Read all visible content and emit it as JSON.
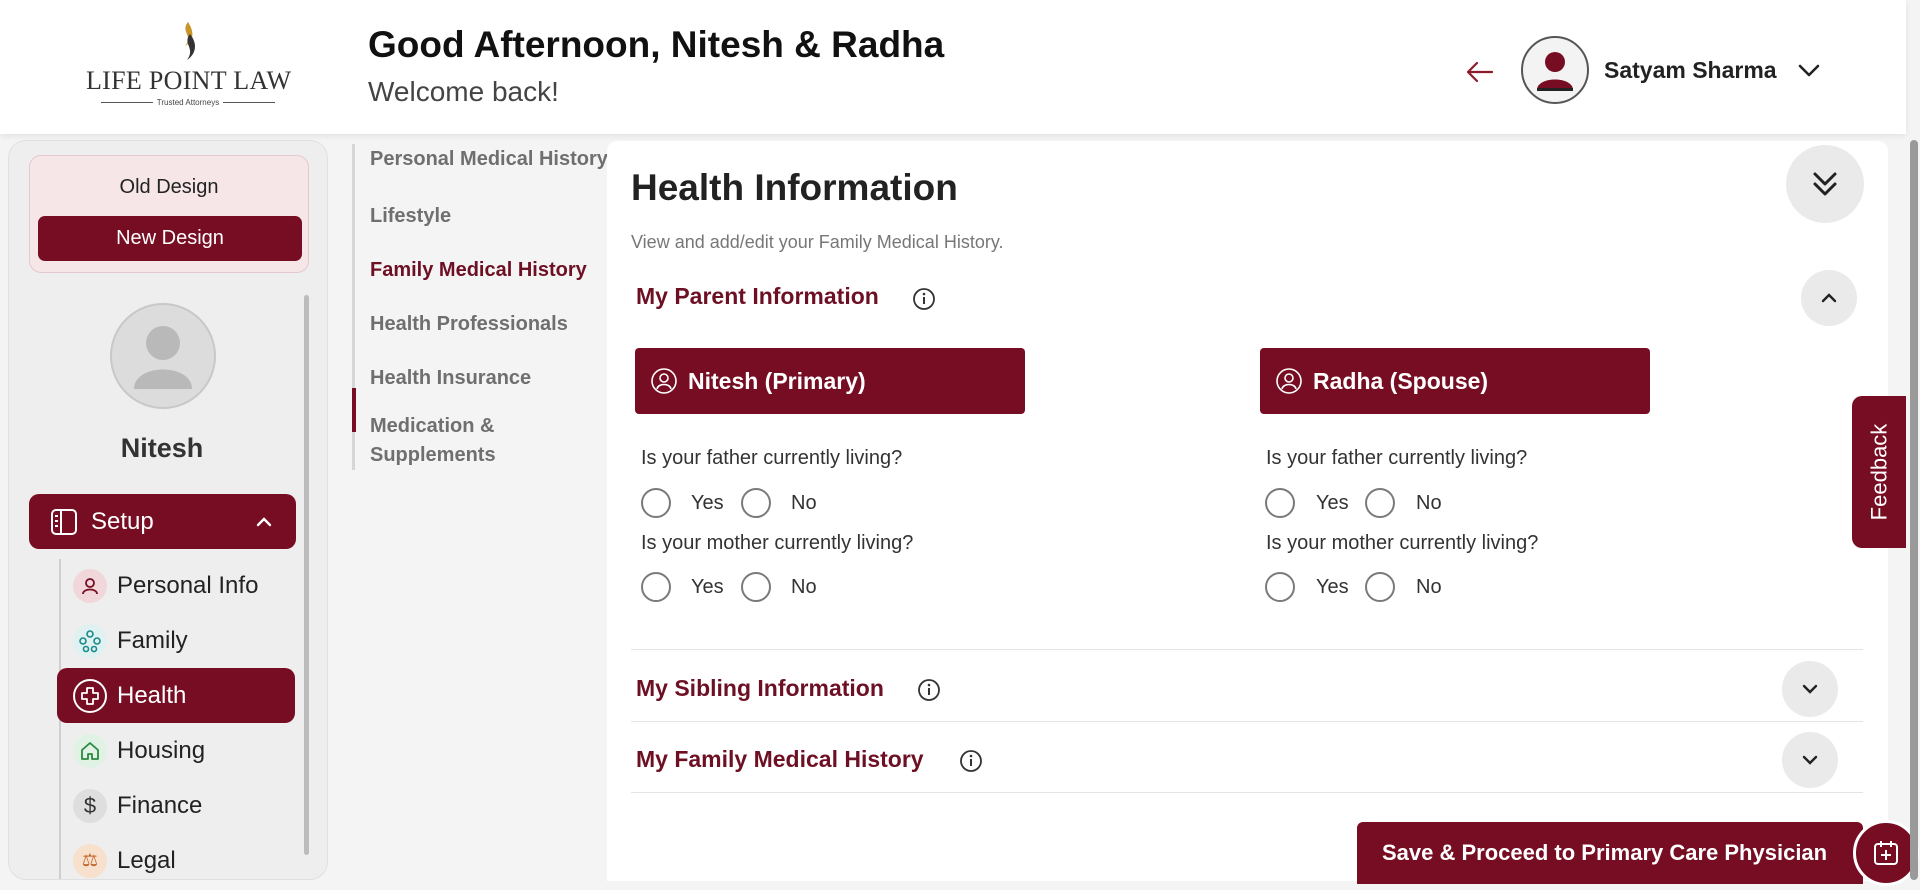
{
  "header": {
    "logo_text": "LIFE POINT LAW",
    "logo_tagline": "Trusted Attorneys",
    "greeting": "Good Afternoon, Nitesh & Radha",
    "welcome": "Welcome back!",
    "user_name": "Satyam Sharma"
  },
  "sidebar": {
    "old_design": "Old Design",
    "new_design": "New Design",
    "profile_name": "Nitesh",
    "setup_label": "Setup",
    "items": [
      {
        "label": "Personal Info",
        "icon": "person-icon"
      },
      {
        "label": "Family",
        "icon": "family-icon"
      },
      {
        "label": "Health",
        "icon": "health-cross-icon",
        "active": true
      },
      {
        "label": "Housing",
        "icon": "house-icon"
      },
      {
        "label": "Finance",
        "icon": "dollar-icon"
      },
      {
        "label": "Legal",
        "icon": "legal-icon"
      }
    ]
  },
  "subnav": {
    "items": [
      "Personal Medical History",
      "Lifestyle",
      "Family Medical History",
      "Health Professionals",
      "Health Insurance",
      "Medication &",
      "Supplements"
    ],
    "active": "Family Medical History"
  },
  "main": {
    "title": "Health Information",
    "subtitle": "View and add/edit your Family Medical History.",
    "sections": {
      "parent": "My Parent Information",
      "sibling": "My Sibling Information",
      "family_history": "My Family Medical History"
    },
    "people": [
      {
        "name": "Nitesh (Primary)"
      },
      {
        "name": "Radha (Spouse)"
      }
    ],
    "questions": {
      "father": "Is your father currently living?",
      "mother": "Is your mother currently living?"
    },
    "options": {
      "yes": "Yes",
      "no": "No"
    }
  },
  "feedback": "Feedback",
  "save_button": "Save & Proceed to Primary Care Physician",
  "colors": {
    "brand": "#760d22",
    "accent_text": "#6e1024"
  }
}
